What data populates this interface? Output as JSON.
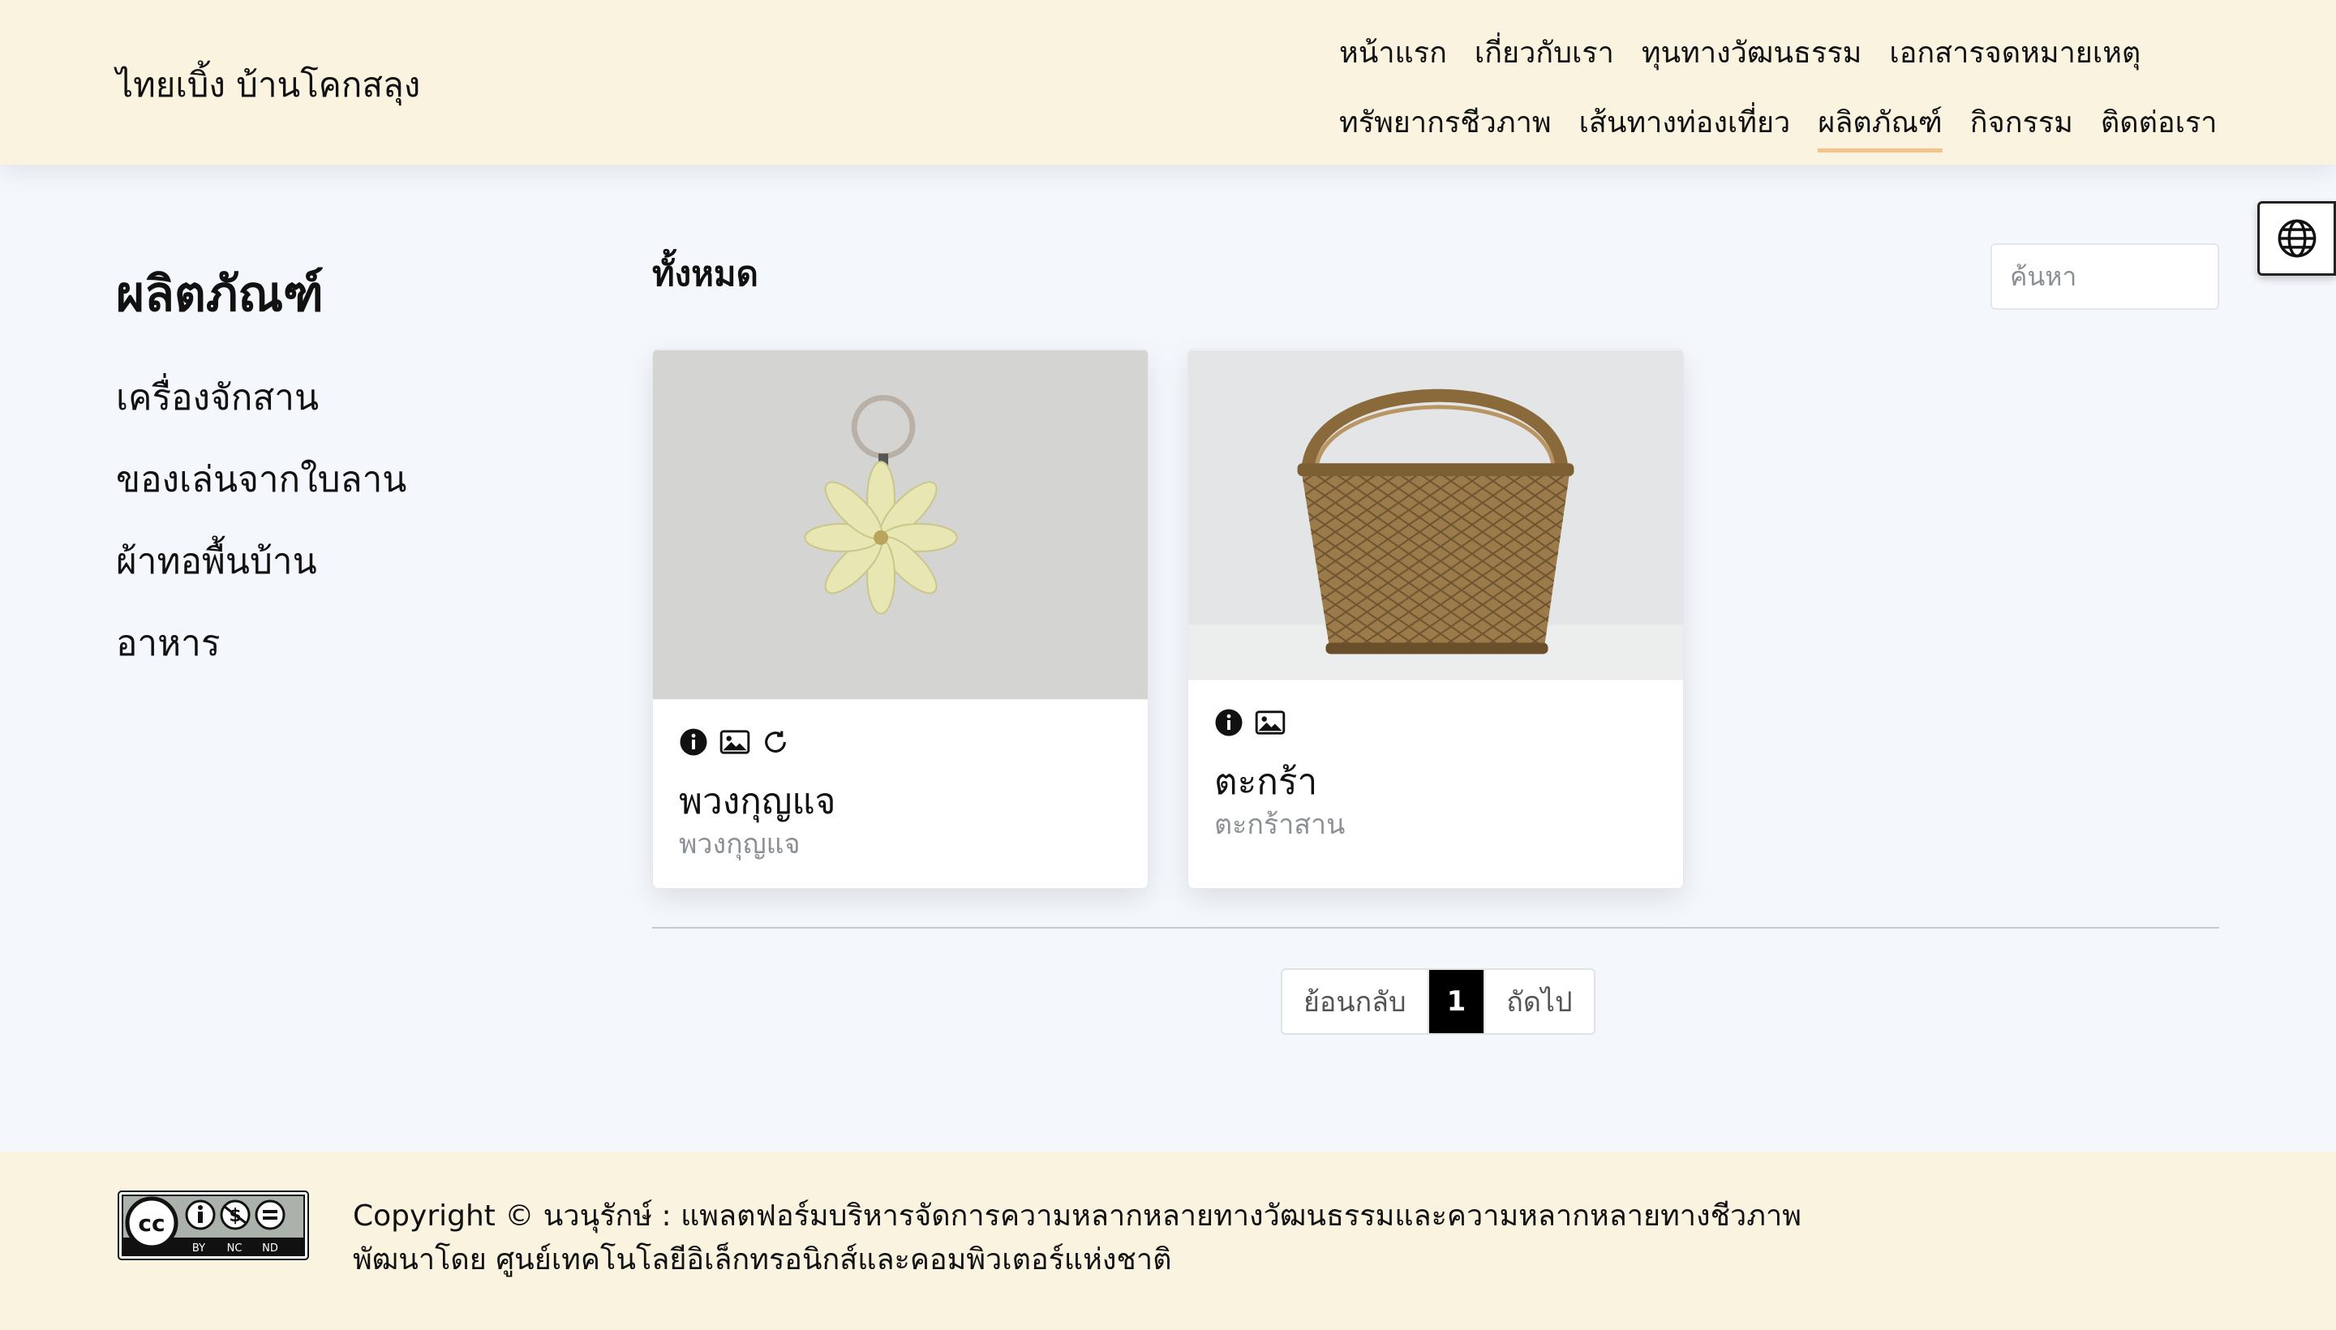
{
  "header": {
    "brand": "ไทยเบิ้ง บ้านโคกสลุง",
    "nav_row1": [
      "หน้าแรก",
      "เกี่ยวกับเรา",
      "ทุนทางวัฒนธรรม",
      "เอกสารจดหมายเหตุ"
    ],
    "nav_row2": [
      "ทรัพยากรชีวภาพ",
      "เส้นทางท่องเที่ยว",
      "ผลิตภัณฑ์",
      "กิจกรรม",
      "ติดต่อเรา"
    ],
    "active_item": "ผลิตภัณฑ์",
    "language_icon": "globe-icon"
  },
  "sidebar": {
    "title": "ผลิตภัณฑ์",
    "items": [
      {
        "label": "เครื่องจักสาน"
      },
      {
        "label": "ของเล่นจากใบลาน"
      },
      {
        "label": "ผ้าทอพื้นบ้าน"
      },
      {
        "label": "อาหาร"
      }
    ]
  },
  "main": {
    "title": "ทั้งหมด",
    "search": {
      "placeholder": "ค้นหา",
      "value": ""
    },
    "products": [
      {
        "title": "พวงกุญแจ",
        "subtitle": "พวงกุญแจ",
        "icons": [
          "info-icon",
          "image-icon",
          "rotate-360-icon"
        ],
        "image": "flower-keychain-photo"
      },
      {
        "title": "ตะกร้า",
        "subtitle": "ตะกร้าสาน",
        "icons": [
          "info-icon",
          "image-icon"
        ],
        "image": "woven-basket-photo"
      }
    ],
    "pagination": {
      "prev": "ย้อนกลับ",
      "current": "1",
      "next": "ถัดไป"
    }
  },
  "footer": {
    "license_badge": "cc-by-nc-nd-icon",
    "line1": "Copyright © นวนุรักษ์ : แพลตฟอร์มบริหารจัดการความหลากหลายทางวัฒนธรรมและความหลากหลายทางชีวภาพ",
    "line2": "พัฒนาโดย ศูนย์เทคโนโลยีอิเล็กทรอนิกส์และคอมพิวเตอร์แห่งชาติ"
  },
  "colors": {
    "header_bg": "#faf3e0",
    "page_bg": "#f4f7fb",
    "active_underline": "#f2c38a",
    "pager_active": "#000000"
  }
}
